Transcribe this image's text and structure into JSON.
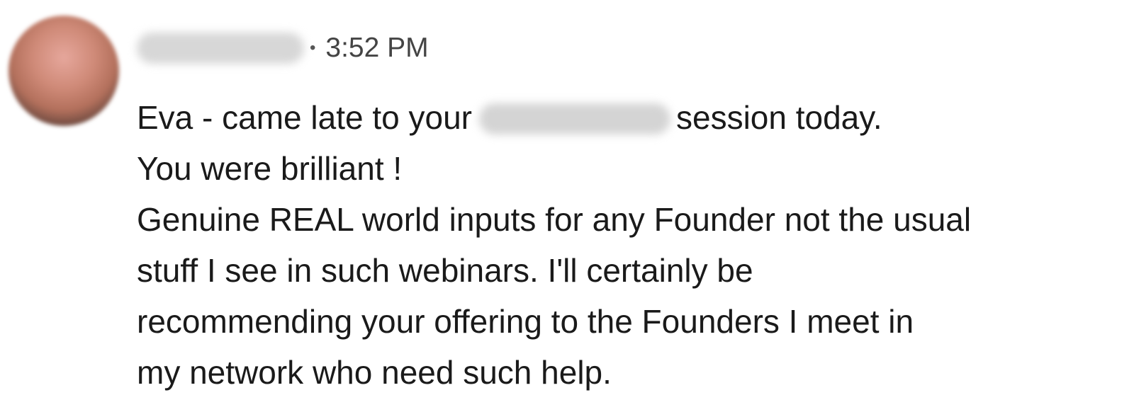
{
  "message": {
    "sender_name": "",
    "separator": "•",
    "timestamp": "3:52 PM",
    "body": {
      "line1_before": "Eva - came late to your",
      "line1_redacted": "",
      "line1_after": "session today.",
      "line2": "You were brilliant !",
      "line3": "Genuine REAL world inputs for any Founder not the usual",
      "line4": "stuff I see in such webinars. I'll certainly be",
      "line5": "recommending your offering to the Founders I meet in",
      "line6": "my network who need such help."
    }
  }
}
